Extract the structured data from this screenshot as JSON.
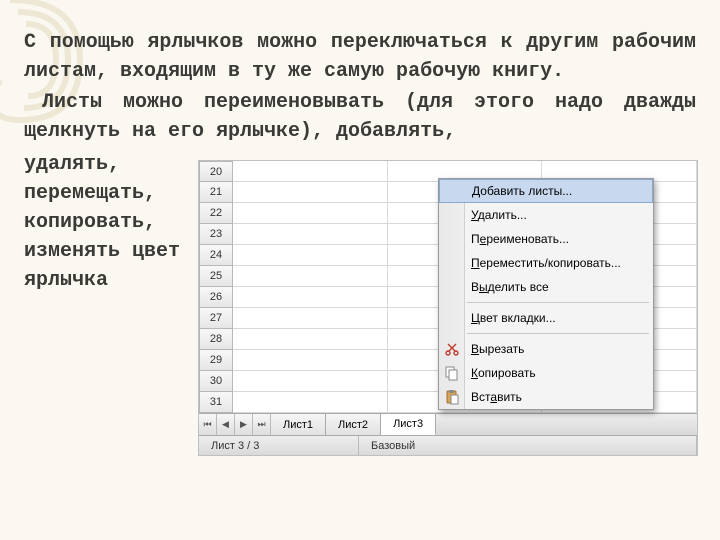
{
  "text": {
    "p1": "С помощью ярлычков можно переключаться к другим рабочим листам, входящим в ту же самую рабочую книгу.",
    "p2": "Листы можно переименовывать (для этого надо дважды щелкнуть на его ярлычке), добавлять,",
    "lines": [
      "удалять,",
      "перемещать,",
      "копировать,",
      "изменять цвет",
      "ярлычка"
    ]
  },
  "grid": {
    "rows": [
      "20",
      "21",
      "22",
      "23",
      "24",
      "25",
      "26",
      "27",
      "28",
      "29",
      "30",
      "31"
    ]
  },
  "tabs": {
    "sheets": [
      "Лист1",
      "Лист2",
      "Лист3"
    ],
    "active_index": 2
  },
  "status": {
    "left": "Лист 3 / 3",
    "right": "Базовый"
  },
  "context_menu": {
    "items": [
      {
        "label": "Добавить листы...",
        "selected": true
      },
      {
        "label": "Удалить..."
      },
      {
        "label": "Переименовать..."
      },
      {
        "label": "Переместить/копировать..."
      },
      {
        "label": "Выделить все"
      },
      {
        "sep": true
      },
      {
        "label": "Цвет вкладки..."
      },
      {
        "sep": true
      },
      {
        "label": "Вырезать",
        "icon": "cut"
      },
      {
        "label": "Копировать",
        "icon": "copy"
      },
      {
        "label": "Вставить",
        "icon": "paste"
      }
    ]
  }
}
